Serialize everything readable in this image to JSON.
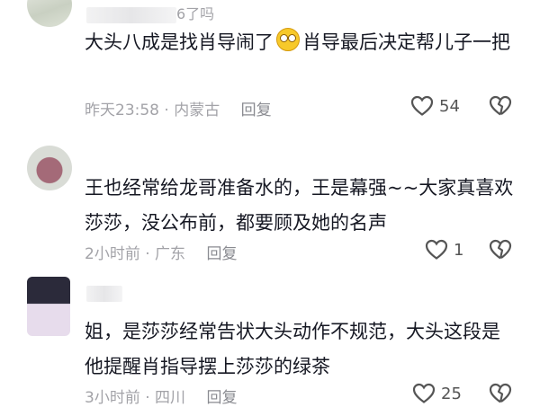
{
  "comments": [
    {
      "name_fragment": "6了吗",
      "text": "大头八成是找肖导闹了",
      "text_after_emoji": "肖导最后决定帮儿子一把",
      "emoji": "grinning-face-emoji",
      "time": "昨天23:58",
      "location": "内蒙古",
      "reply": "回复",
      "likes": "54"
    },
    {
      "name_fragment": "",
      "text": "王也经常给龙哥准备水的，王是幕强~~大家真喜欢莎莎，没公布前，都要顾及她的名声",
      "time": "2小时前",
      "location": "广东",
      "reply": "回复",
      "likes": "1"
    },
    {
      "name_fragment": "",
      "text": "姐，是莎莎经常告状大头动作不规范，大头这段是他提醒肖指导摆上莎莎的绿茶",
      "time": "3小时前",
      "location": "四川",
      "reply": "回复",
      "likes": "25"
    }
  ],
  "separator": "·",
  "colors": {
    "text": "#161823",
    "meta": "#a3a3a8",
    "background": "#ffffff"
  }
}
